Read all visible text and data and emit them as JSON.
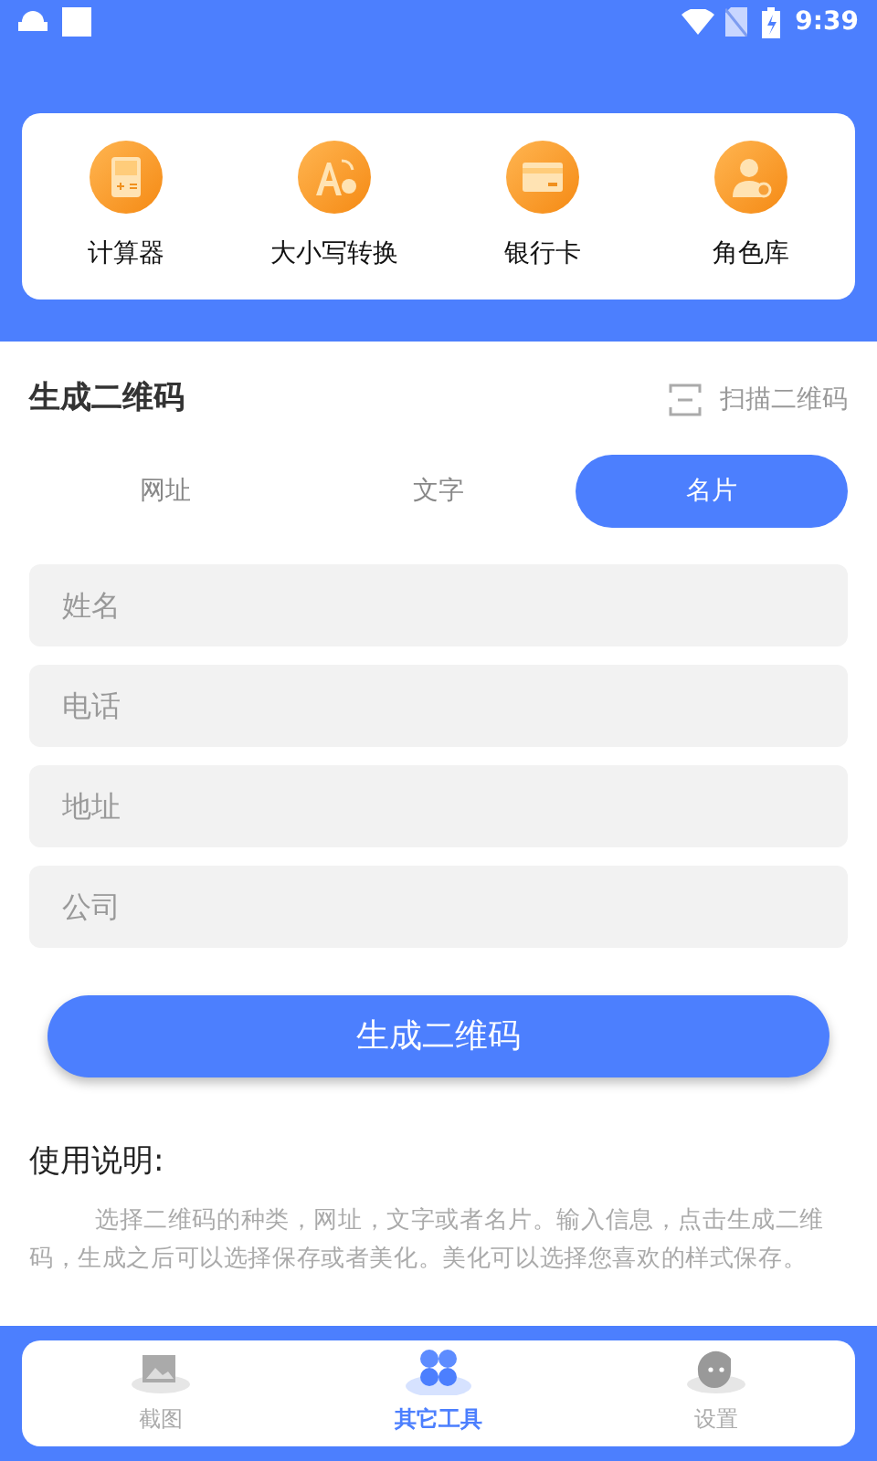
{
  "status_bar": {
    "time": "9:39"
  },
  "tools": [
    {
      "label": "计算器",
      "kind": "calculator"
    },
    {
      "label": "大小写转换",
      "kind": "case"
    },
    {
      "label": "银行卡",
      "kind": "card"
    },
    {
      "label": "角色库",
      "kind": "role"
    }
  ],
  "section": {
    "title": "生成二维码",
    "scan_link": "扫描二维码"
  },
  "tabs": [
    {
      "label": "网址",
      "selected": false
    },
    {
      "label": "文字",
      "selected": false
    },
    {
      "label": "名片",
      "selected": true
    }
  ],
  "fields": [
    {
      "placeholder": "姓名"
    },
    {
      "placeholder": "电话"
    },
    {
      "placeholder": "地址"
    },
    {
      "placeholder": "公司"
    }
  ],
  "generate_button": "生成二维码",
  "usage": {
    "title": "使用说明:",
    "text": "选择二维码的种类，网址，文字或者名片。输入信息，点击生成二维码，生成之后可以选择保存或者美化。美化可以选择您喜欢的样式保存。"
  },
  "bottom_nav": [
    {
      "label": "截图",
      "kind": "screenshot",
      "selected": false
    },
    {
      "label": "其它工具",
      "kind": "tools",
      "selected": true
    },
    {
      "label": "设置",
      "kind": "settings",
      "selected": false
    }
  ]
}
